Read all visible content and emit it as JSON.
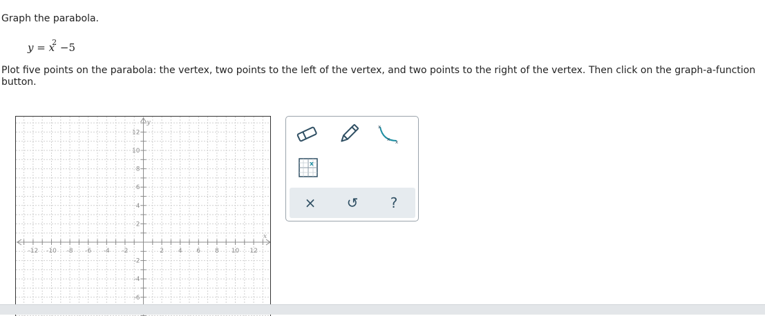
{
  "prompt": "Graph the parabola.",
  "equation": {
    "lhs": "y",
    "equals": "=",
    "base": "x",
    "exponent": "2",
    "rest": "−5"
  },
  "instructions": "Plot five points on the parabola: the vertex, two points to the left of the vertex, and two points to the right of the vertex. Then click on the graph-a-function button.",
  "graph": {
    "x_axis_label": "x",
    "y_axis_label": "y",
    "x_tick_labels": [
      "-12",
      "-10",
      "-8",
      "-6",
      "-4",
      "-2",
      "2",
      "4",
      "6",
      "8",
      "10",
      "12"
    ],
    "y_tick_labels": [
      "12",
      "10",
      "8",
      "6",
      "4",
      "2",
      "-2",
      "-4",
      "-6"
    ]
  },
  "tools": {
    "eraser": "eraser-icon",
    "pencil": "pencil-icon",
    "graph_function": "graph-a-function-icon",
    "point_grid": "point-grid-icon"
  },
  "actions": {
    "clear": "×",
    "undo": "↺",
    "help": "?"
  },
  "colors": {
    "accent": "#1f8fa3",
    "icon": "#2f4f63",
    "grid": "#cfcfcf"
  }
}
